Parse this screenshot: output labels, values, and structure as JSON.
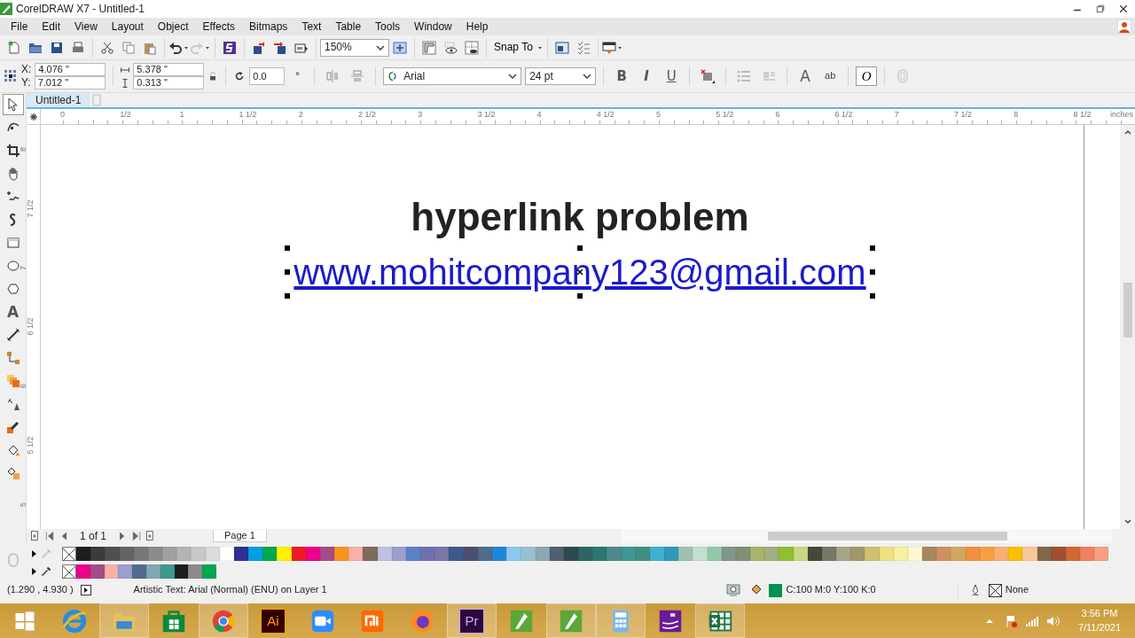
{
  "window": {
    "title": "CorelDRAW X7 - Untitled-1"
  },
  "menu": [
    "File",
    "Edit",
    "View",
    "Layout",
    "Object",
    "Effects",
    "Bitmaps",
    "Text",
    "Table",
    "Tools",
    "Window",
    "Help"
  ],
  "toolbar": {
    "zoom": "150%",
    "snap": "Snap To"
  },
  "property_bar": {
    "position_fields": [
      {
        "label": "X:",
        "value": "4.076 \""
      },
      {
        "label": "Y:",
        "value": "7.012 \""
      }
    ],
    "size_fields": [
      {
        "value": "5.378 \""
      },
      {
        "value": "0.313 \""
      }
    ],
    "angle": "0.0",
    "degree": "°",
    "font": "Arial",
    "font_size": "24 pt",
    "style_buttons": [
      {
        "label": "B",
        "kind": "bold"
      },
      {
        "label": "I",
        "kind": "italic"
      },
      {
        "label": "U",
        "kind": "underline"
      }
    ],
    "text_properties": "A",
    "edit_text": "ab",
    "text_mode": "O"
  },
  "toolbox": [
    {
      "selected": true
    },
    {
      "selected": false
    },
    {
      "selected": false
    },
    {
      "selected": false
    },
    {
      "selected": false
    },
    {
      "selected": false
    },
    {
      "selected": false
    },
    {
      "selected": false
    },
    {
      "selected": false
    },
    {
      "selected": false,
      "label": "A"
    },
    {
      "selected": false
    },
    {
      "selected": false
    },
    {
      "selected": false
    },
    {
      "selected": false
    },
    {
      "selected": false
    },
    {
      "selected": false
    },
    {
      "selected": false
    }
  ],
  "document_tab": {
    "label": "Untitled-1",
    "selected": true
  },
  "ruler": {
    "horizontal": [
      "0",
      "1/2",
      "1",
      "1 1/2",
      "2",
      "2 1/2",
      "3",
      "3 1/2",
      "4",
      "4 1/2",
      "5",
      "5 1/2",
      "6",
      "6 1/2",
      "7",
      "7 1/2",
      "8",
      "8 1/2"
    ],
    "unit": "inches",
    "vertical": [
      "8",
      "7 1/2",
      "7",
      "6 1/2",
      "6",
      "5 1/2",
      "5"
    ]
  },
  "canvas": {
    "title": "hyperlink problem",
    "link": {
      "text": "www.mohitcompany123@gmail.com",
      "selected": true
    }
  },
  "page_nav": {
    "counter": "1 of 1",
    "page_tab": "Page 1"
  },
  "palette": {
    "row_1": [
      {
        "color": "#1e1e1e"
      },
      {
        "color": "#3c3c3c"
      },
      {
        "color": "#505050"
      },
      {
        "color": "#646464"
      },
      {
        "color": "#787878"
      },
      {
        "color": "#8c8c8c"
      },
      {
        "color": "#a0a0a0"
      },
      {
        "color": "#b4b4b4"
      },
      {
        "color": "#c8c8c8"
      },
      {
        "color": "#dcdcdc"
      },
      {
        "color": "#ffffff"
      },
      {
        "color": "#2e3192"
      },
      {
        "color": "#00a0e3"
      },
      {
        "color": "#00a651"
      },
      {
        "color": "#fff200"
      },
      {
        "color": "#ed1c24"
      },
      {
        "color": "#ec008c"
      },
      {
        "color": "#a54b8a"
      },
      {
        "color": "#f7941d"
      },
      {
        "color": "#f9b0a6"
      },
      {
        "color": "#7d6b5d"
      },
      {
        "color": "#c0c0e0"
      },
      {
        "color": "#9a9ed0"
      },
      {
        "color": "#5a82c8"
      },
      {
        "color": "#7070b0"
      },
      {
        "color": "#7878a8"
      },
      {
        "color": "#3c5a8c"
      },
      {
        "color": "#4c5070"
      },
      {
        "color": "#506c8c"
      },
      {
        "color": "#1e88d8"
      },
      {
        "color": "#8cc8f0"
      },
      {
        "color": "#98c0d0"
      },
      {
        "color": "#8ca8b4"
      },
      {
        "color": "#506070"
      },
      {
        "color": "#2c4a50"
      },
      {
        "color": "#2e6464"
      },
      {
        "color": "#2a7870"
      },
      {
        "color": "#508890"
      },
      {
        "color": "#3c9890"
      },
      {
        "color": "#409080"
      },
      {
        "color": "#40b0d0"
      },
      {
        "color": "#3098b8"
      },
      {
        "color": "#a0c0b0"
      },
      {
        "color": "#c0e0d0"
      },
      {
        "color": "#90c8a8"
      },
      {
        "color": "#809888"
      },
      {
        "color": "#809070"
      },
      {
        "color": "#a8b468"
      },
      {
        "color": "#a0b080"
      },
      {
        "color": "#90c030"
      },
      {
        "color": "#c8d880"
      },
      {
        "color": "#484838"
      },
      {
        "color": "#787868"
      },
      {
        "color": "#a8a488"
      },
      {
        "color": "#a09868"
      },
      {
        "color": "#d0c070"
      },
      {
        "color": "#f0e080"
      },
      {
        "color": "#f8f0a0"
      },
      {
        "color": "#fff8d0"
      },
      {
        "color": "#a88860"
      },
      {
        "color": "#d09060"
      },
      {
        "color": "#d0a860"
      },
      {
        "color": "#f09040"
      },
      {
        "color": "#f8a040"
      },
      {
        "color": "#f8b070"
      },
      {
        "color": "#f8c000"
      },
      {
        "color": "#f8c898"
      },
      {
        "color": "#806848"
      },
      {
        "color": "#a05030"
      },
      {
        "color": "#d06830"
      },
      {
        "color": "#f08060"
      },
      {
        "color": "#f8a080"
      }
    ],
    "row_2": [
      {
        "color": "#ec008c"
      },
      {
        "color": "#a54b8a"
      },
      {
        "color": "#f9b0a6"
      },
      {
        "color": "#9a9ed0"
      },
      {
        "color": "#506c8c"
      },
      {
        "color": "#7fa8b0"
      },
      {
        "color": "#3c9890"
      },
      {
        "color": "#1e1e1e"
      },
      {
        "color": "#8c8c8c"
      },
      {
        "color": "#00a651"
      }
    ]
  },
  "status_bar": {
    "coordinates": "(1.290 , 4.930 )",
    "info": "Artistic Text: Arial (Normal) (ENU) on Layer 1",
    "fill": {
      "color": "#009150",
      "text": "C:100 M:0 Y:100 K:0"
    },
    "outline": "None"
  },
  "taskbar": {
    "apps": [
      {
        "kind": "start",
        "running": false
      },
      {
        "kind": "ie",
        "running": false
      },
      {
        "kind": "explorer",
        "running": true
      },
      {
        "kind": "store",
        "running": false
      },
      {
        "kind": "chrome",
        "running": true
      },
      {
        "kind": "illustrator",
        "label": "Ai",
        "running": false
      },
      {
        "kind": "zoom",
        "running": false
      },
      {
        "kind": "mi",
        "running": false
      },
      {
        "kind": "firefox",
        "running": false
      },
      {
        "kind": "premiere",
        "label": "Pr",
        "running": true
      },
      {
        "kind": "corel",
        "running": false
      },
      {
        "kind": "corel",
        "running": true
      },
      {
        "kind": "calculator",
        "running": true
      },
      {
        "kind": "purple",
        "running": false
      },
      {
        "kind": "excel",
        "running": true
      }
    ],
    "time": "3:56 PM",
    "date": "7/11/2021"
  }
}
